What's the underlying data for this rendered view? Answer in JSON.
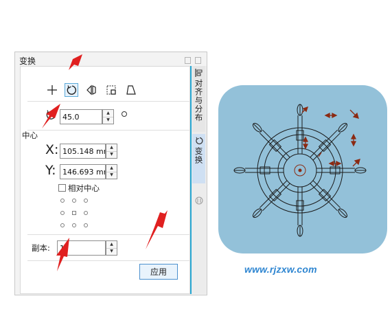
{
  "docker": {
    "title": "变换",
    "tabs": [
      {
        "label": "对齐与分布"
      },
      {
        "label": "变换"
      }
    ]
  },
  "toolbar": {
    "tools": [
      {
        "icon": "position-icon"
      },
      {
        "icon": "rotate-icon",
        "active": true
      },
      {
        "icon": "mirror-icon"
      },
      {
        "icon": "size-icon"
      },
      {
        "icon": "skew-icon"
      }
    ]
  },
  "rotation": {
    "angle": "45.0"
  },
  "center": {
    "label": "中心",
    "x_label": "X:",
    "x_value": "105.148 mm",
    "y_label": "Y:",
    "y_value": "146.693 mm",
    "relative_label": "相对中心",
    "relative_checked": false
  },
  "copies": {
    "label": "副本:",
    "value": "1"
  },
  "apply_label": "应用",
  "watermark": "www.rjzxw.com",
  "colors": {
    "accent": "#29a8d3",
    "annotation_arrow": "#e02020",
    "preview_bg": "#93c1d9",
    "preview_stroke": "#1a1a1a",
    "transform_handles": "#8b2a12"
  }
}
